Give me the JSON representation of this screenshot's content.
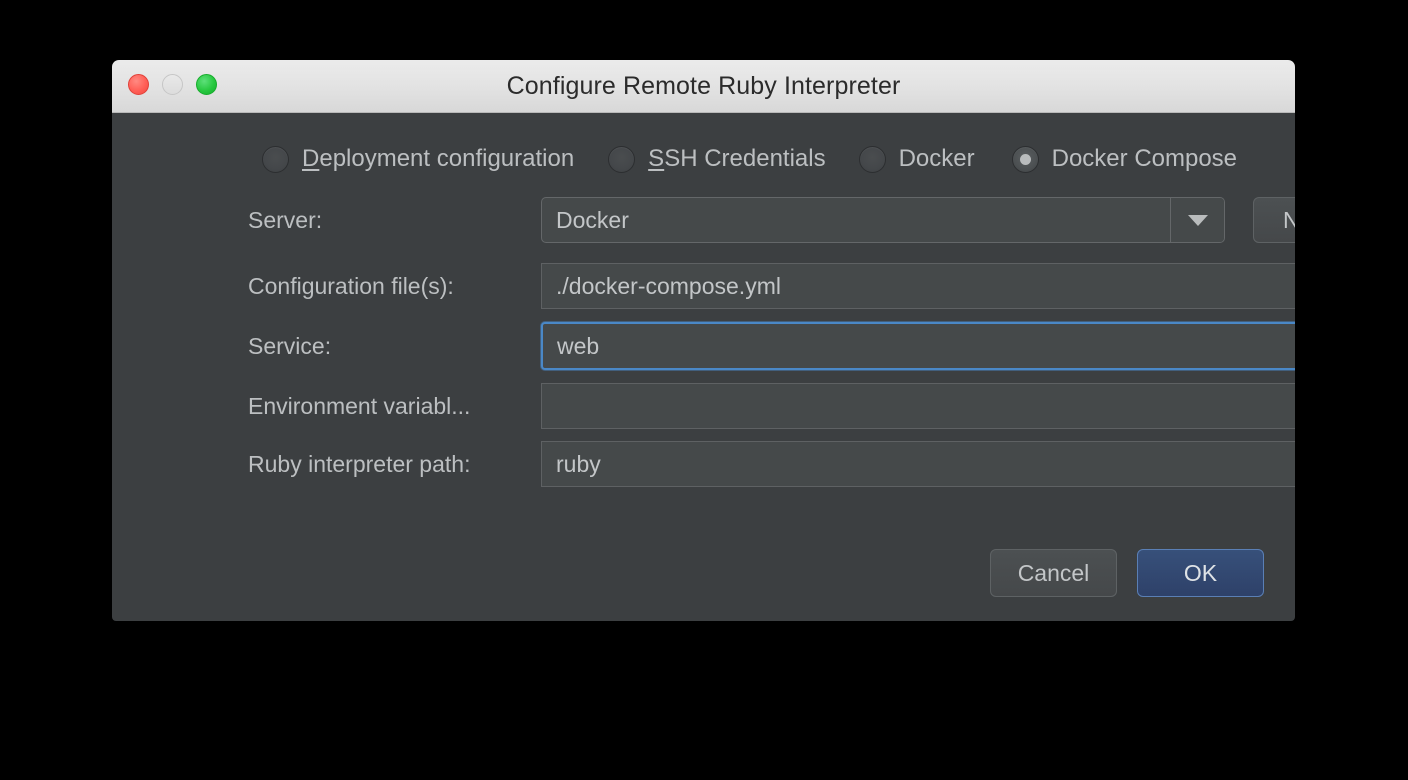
{
  "window": {
    "title": "Configure Remote Ruby Interpreter",
    "traffic_lights": [
      {
        "name": "close-button",
        "color": "#ff5f57"
      },
      {
        "name": "minimize-button",
        "color": "#e3e3e3"
      },
      {
        "name": "zoom-button",
        "color": "#28c840"
      }
    ]
  },
  "interpreter_type": {
    "selected": "Docker Compose",
    "options": [
      {
        "label": "Deployment configuration",
        "mnemonic": "D",
        "selected": false
      },
      {
        "label": "SSH Credentials",
        "mnemonic": "S",
        "selected": false
      },
      {
        "label": "Docker",
        "mnemonic": "",
        "selected": false
      },
      {
        "label": "Docker Compose",
        "mnemonic": "",
        "selected": true
      }
    ]
  },
  "form": {
    "server": {
      "label": "Server:",
      "value": "Docker",
      "new_button": "New..."
    },
    "configuration_files": {
      "label": "Configuration file(s):",
      "value": "./docker-compose.yml",
      "browse": "..."
    },
    "service": {
      "label": "Service:",
      "value": "web",
      "focused": true
    },
    "environment_variables": {
      "label": "Environment variabl...",
      "value": "",
      "placeholder": "",
      "browse": "..."
    },
    "ruby_interpreter_path": {
      "label": "Ruby interpreter path:",
      "value": "ruby"
    }
  },
  "footer": {
    "cancel": "Cancel",
    "ok": "OK"
  },
  "colors": {
    "dialog_background": "#3c3f41",
    "titlebar_background": "#e3e3e3",
    "field_background": "#45494a",
    "text": "#bcbfc1",
    "focus_border": "#4a88c7",
    "default_button": "#37507a"
  }
}
